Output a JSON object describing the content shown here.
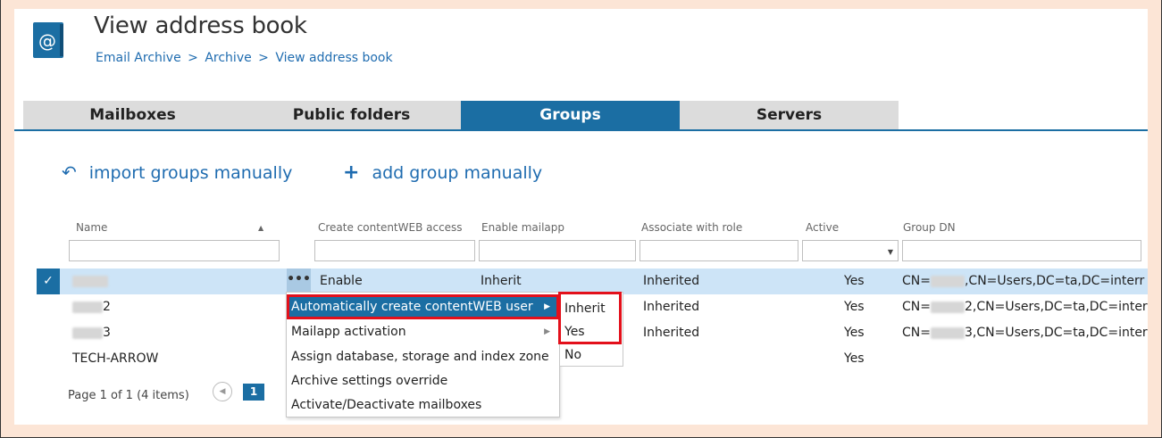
{
  "header": {
    "title": "View address book",
    "breadcrumb": [
      "Email Archive",
      "Archive",
      "View address book"
    ],
    "breadcrumb_separator": ">",
    "icon": "address-book-at-icon"
  },
  "tabs": [
    {
      "label": "Mailboxes",
      "active": false
    },
    {
      "label": "Public folders",
      "active": false
    },
    {
      "label": "Groups",
      "active": true
    },
    {
      "label": "Servers",
      "active": false
    }
  ],
  "actions": {
    "import": {
      "glyph": "↶",
      "label": "import groups manually"
    },
    "add": {
      "glyph": "+",
      "label": "add group manually"
    }
  },
  "grid": {
    "columns": {
      "name": "Name",
      "name_sort": "▲",
      "content": "Create contentWEB access",
      "mailapp": "Enable mailapp",
      "role": "Associate with role",
      "active": "Active",
      "dn": "Group DN"
    },
    "rows": [
      {
        "name": "",
        "content": "Enable",
        "mailapp": "Inherit",
        "role": "Inherited",
        "active": "Yes",
        "dn_prefix": "CN=",
        "dn_suffix": ",CN=Users,DC=ta,DC=interr",
        "selected": true
      },
      {
        "name": "2",
        "content": "",
        "mailapp": "",
        "role": "Inherited",
        "active": "Yes",
        "dn_prefix": "CN=",
        "dn_suffix": "2,CN=Users,DC=ta,DC=inter",
        "selected": false
      },
      {
        "name": "3",
        "content": "",
        "mailapp": "",
        "role": "Inherited",
        "active": "Yes",
        "dn_prefix": "CN=",
        "dn_suffix": "3,CN=Users,DC=ta,DC=inter",
        "selected": false
      },
      {
        "name": "TECH-ARROW",
        "content": "",
        "mailapp": "",
        "role": "",
        "active": "Yes",
        "dn_prefix": "",
        "dn_suffix": "",
        "selected": false
      }
    ],
    "checkmark": "✓",
    "row_actions": "•••"
  },
  "pager": {
    "text": "Page 1 of 1 (4 items)",
    "current": "1",
    "prev_glyph": "◀"
  },
  "context_menu": {
    "items": [
      {
        "label": "Automatically create contentWEB user",
        "has_submenu": true,
        "highlight": true
      },
      {
        "label": "Mailapp activation",
        "has_submenu": true,
        "highlight": false
      },
      {
        "label": "Assign database, storage and index zone",
        "has_submenu": false,
        "highlight": false
      },
      {
        "label": "Archive settings override",
        "has_submenu": false,
        "highlight": false
      },
      {
        "label": "Activate/Deactivate mailboxes",
        "has_submenu": false,
        "highlight": false
      }
    ],
    "submenu_arrow": "▶",
    "submenu": [
      "Inherit",
      "Yes",
      "No"
    ]
  },
  "colors": {
    "accent": "#1b6ea3",
    "highlight_border": "#e3101b",
    "background": "#fce5d6"
  }
}
